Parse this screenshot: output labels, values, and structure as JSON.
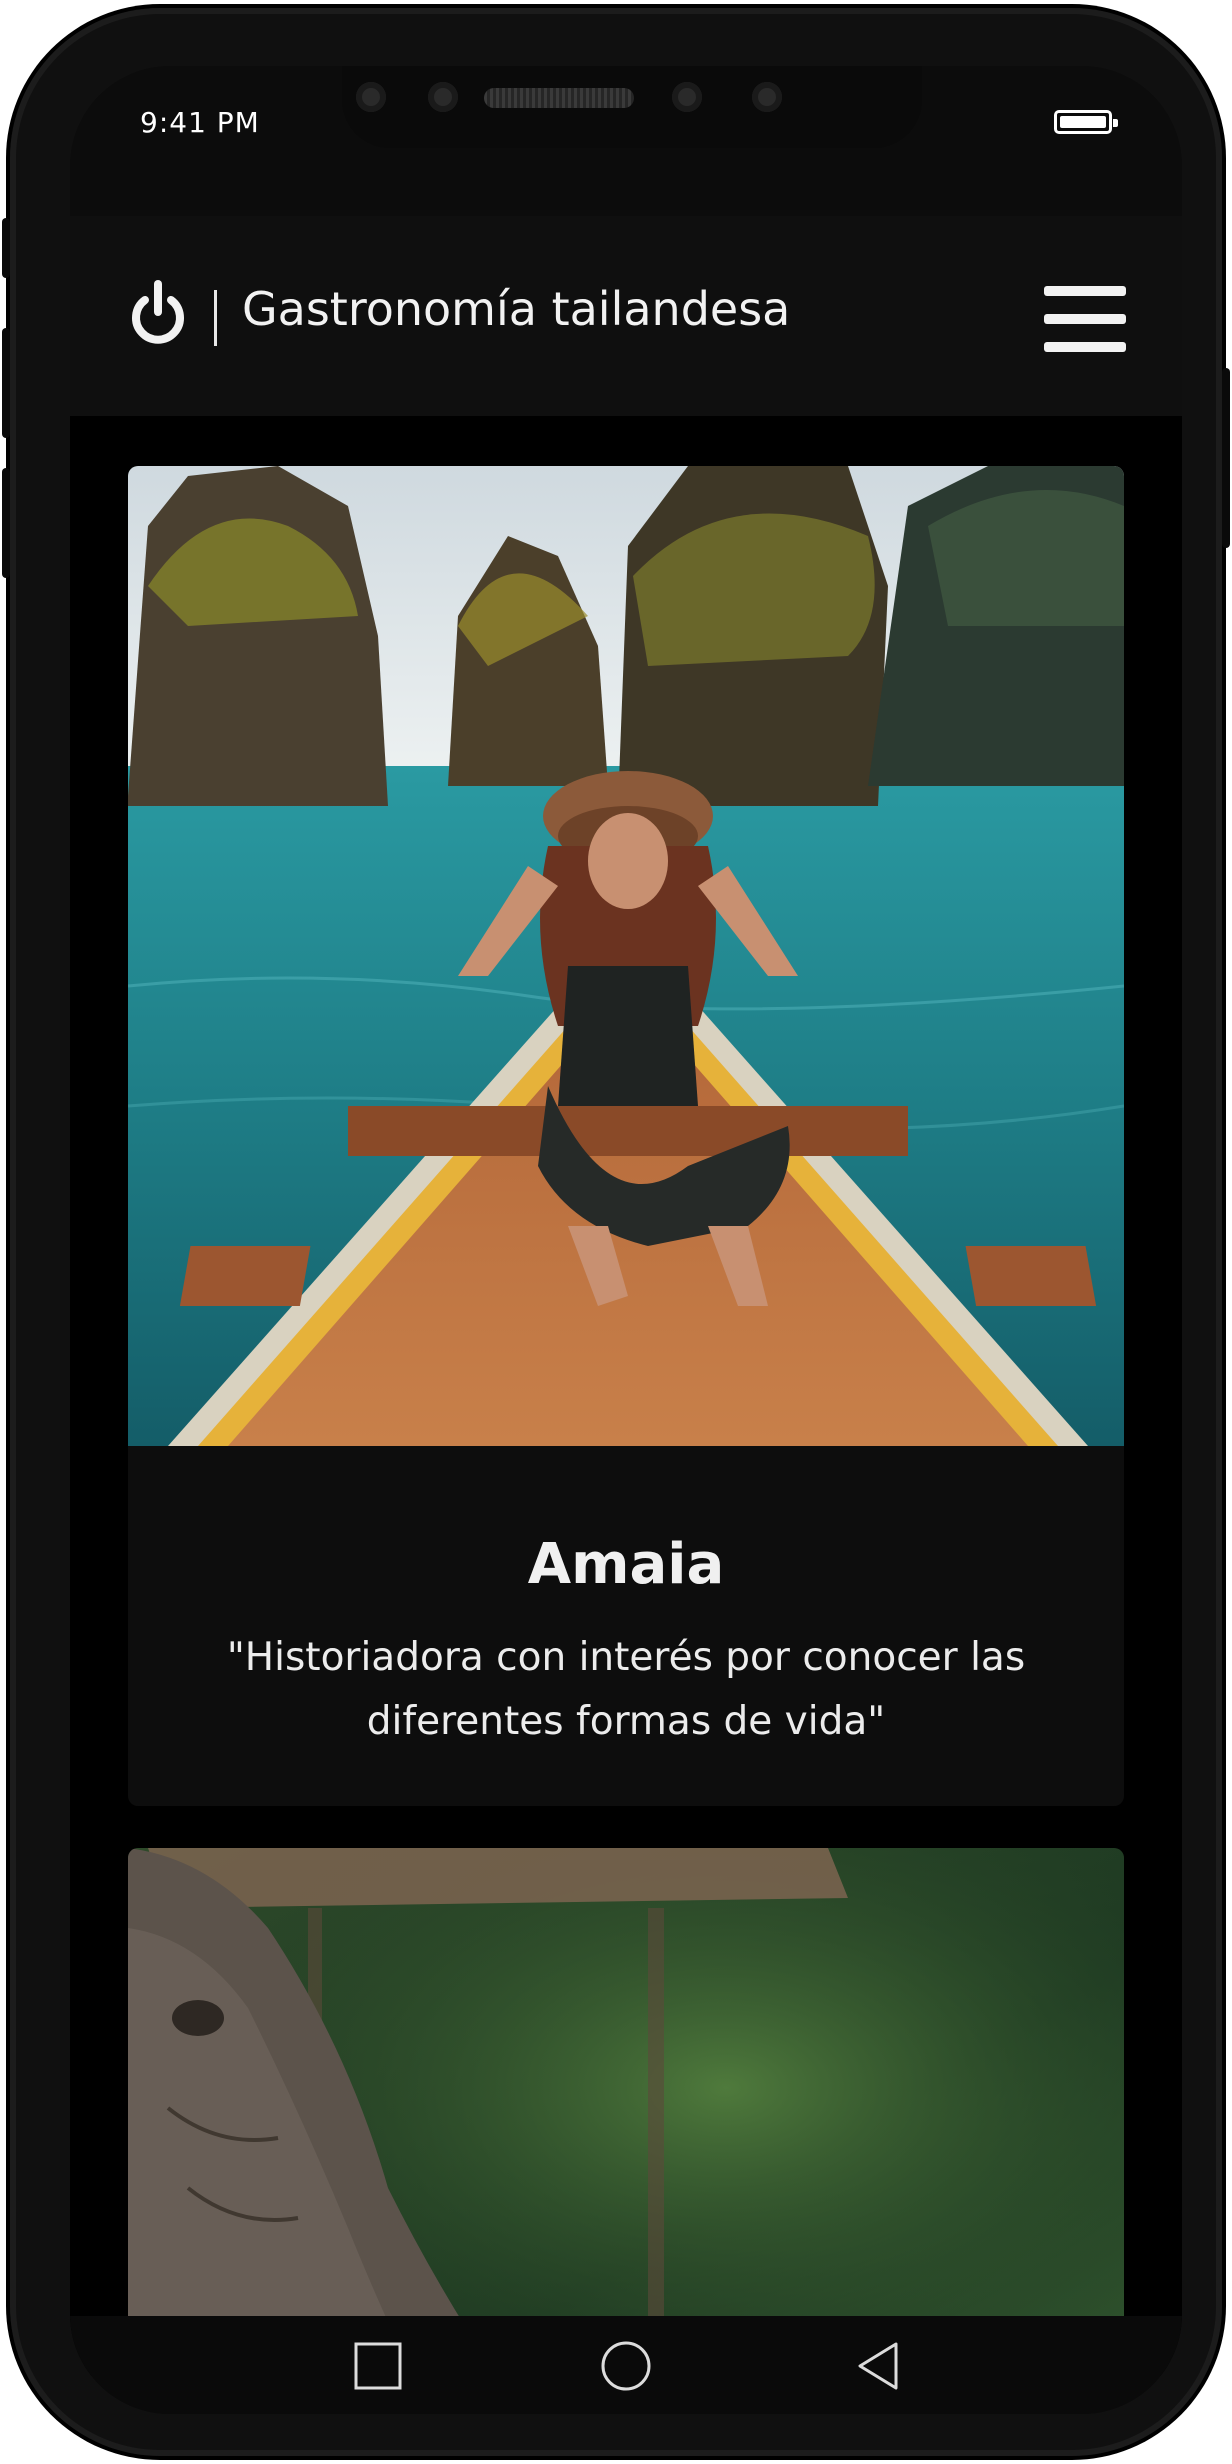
{
  "status_bar": {
    "time": "9:41 PM"
  },
  "header": {
    "logo_icon": "power-icon",
    "title": "Gastronomía tailandesa",
    "menu_icon": "hamburger-menu-icon"
  },
  "cards": [
    {
      "image": "woman-in-hat-on-longtail-boat-photo",
      "name": "Amaia",
      "quote": "\"Historiadora con interés por conocer las diferentes formas de vida\""
    },
    {
      "image": "elephant-and-woman-photo"
    }
  ],
  "nav_bar": {
    "items": [
      "square-recents-icon",
      "circle-home-icon",
      "triangle-back-icon"
    ]
  },
  "colors": {
    "background": "#000000",
    "header": "#0f0f0f",
    "card": "#0d0d0d",
    "text": "#f0f0f0",
    "water": "#1f7f86"
  }
}
